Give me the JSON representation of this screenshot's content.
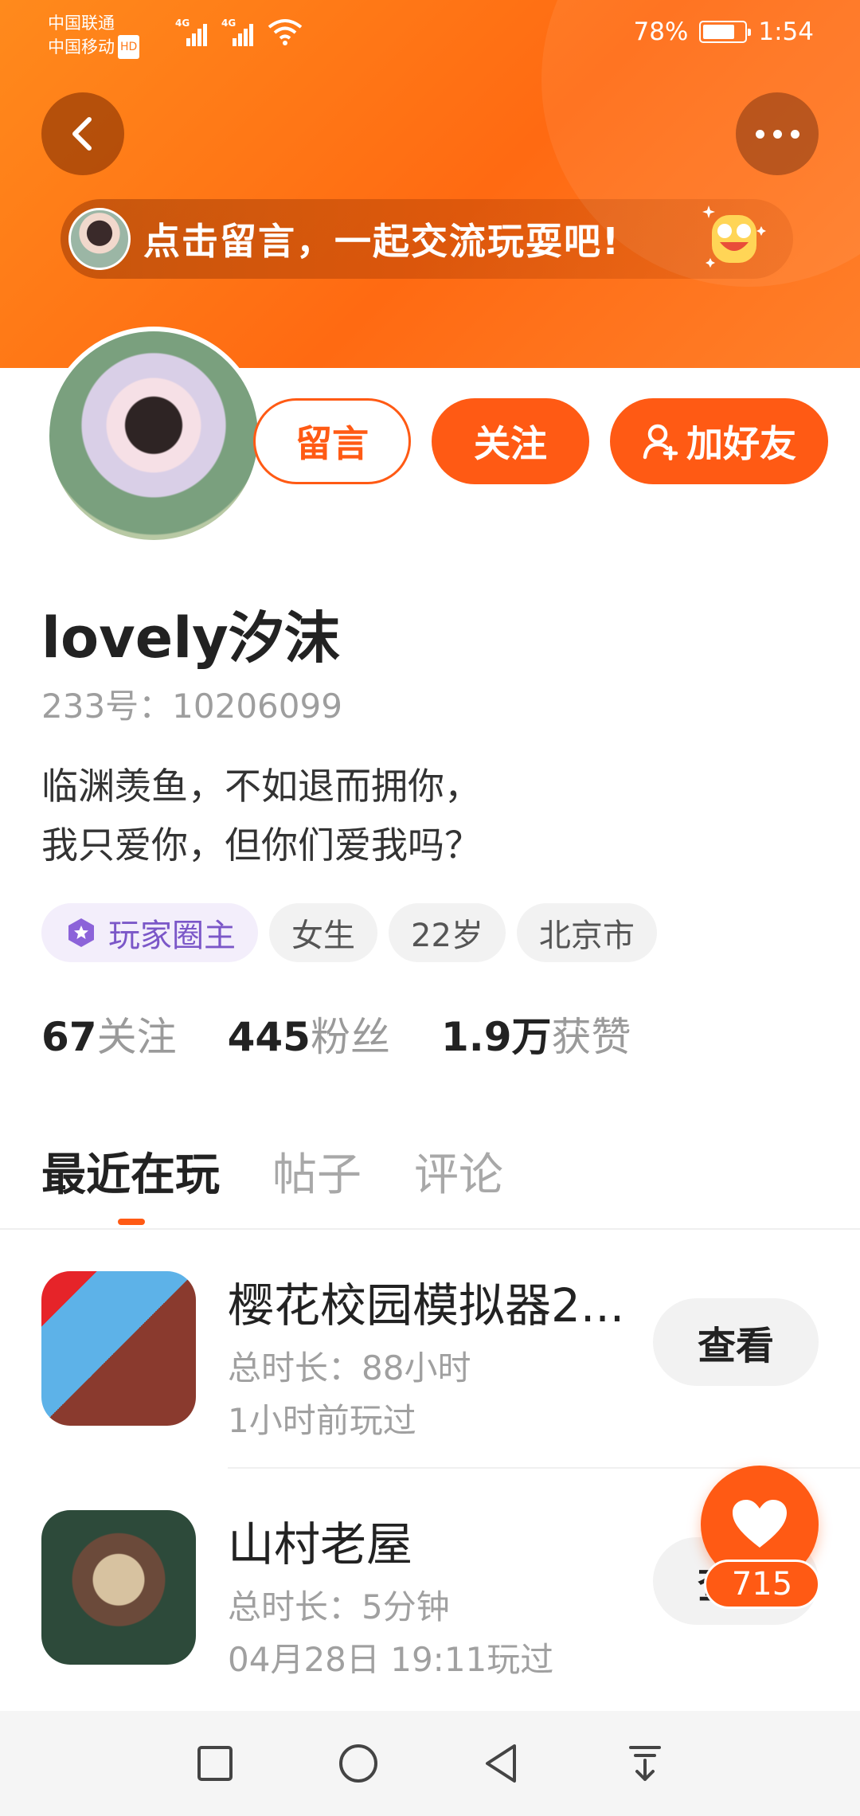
{
  "status_bar": {
    "carrier_1": "中国联通",
    "carrier_2": "中国移动",
    "hd_badge": "HD",
    "network_1": "4G",
    "network_2": "4G",
    "battery": "78%",
    "battery_level": 0.78,
    "time": "1:54"
  },
  "header": {
    "back_icon": "chevron-left-icon",
    "more_icon": "more-horizontal-icon",
    "banner_text": "点击留言，一起交流玩耍吧!"
  },
  "profile": {
    "actions": {
      "comment_label": "留言",
      "follow_label": "关注",
      "add_friend_label": "加好友"
    },
    "username": "lovely汐沫",
    "user_id": "233号：10206099",
    "bio_line_1": "临渊羡鱼，不如退而拥你，",
    "bio_line_2": "我只爱你，但你们爱我吗？",
    "tags": [
      "玩家圈主",
      "女生",
      "22岁",
      "北京市"
    ],
    "stats": [
      {
        "value": "67",
        "label": "关注"
      },
      {
        "value": "445",
        "label": "粉丝"
      },
      {
        "value": "1.9万",
        "label": "获赞"
      }
    ]
  },
  "tabs": [
    "最近在玩",
    "帖子",
    "评论"
  ],
  "games": [
    {
      "title": "樱花校园模拟器2...",
      "duration": "总时长：88小时",
      "last_played": "1小时前玩过",
      "button": "查看"
    },
    {
      "title": "山村老屋",
      "duration": "总时长：5分钟",
      "last_played": "04月28日 19:11玩过",
      "button": "查看"
    }
  ],
  "like_count": "715",
  "colors": {
    "accent": "#ff5a14",
    "header_orange": "#ff7a1a",
    "owner_tag_purple": "#7b57c8"
  }
}
